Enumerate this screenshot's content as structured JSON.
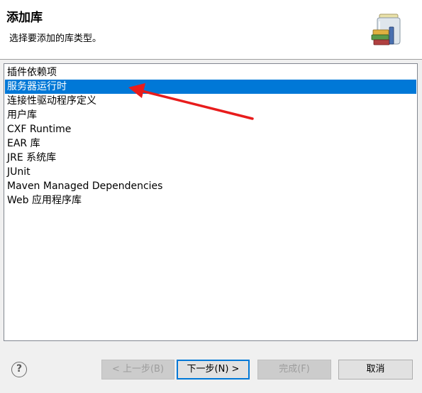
{
  "header": {
    "title": "添加库",
    "description": "选择要添加的库类型。",
    "icon": "library-jar-books-icon"
  },
  "library_types": {
    "items": [
      "插件依赖项",
      "服务器运行时",
      "连接性驱动程序定义",
      "用户库",
      "CXF Runtime",
      "EAR 库",
      "JRE 系统库",
      "JUnit",
      "Maven Managed Dependencies",
      "Web 应用程序库"
    ],
    "selected": "服务器运行时"
  },
  "buttons": {
    "help": "?",
    "back": "< 上一步(B)",
    "next": "下一步(N) >",
    "finish": "完成(F)",
    "cancel": "取消"
  },
  "colors": {
    "selection": "#0078d7",
    "arrow": "#e81c1c",
    "dialog_bg": "#f0f0f0"
  }
}
